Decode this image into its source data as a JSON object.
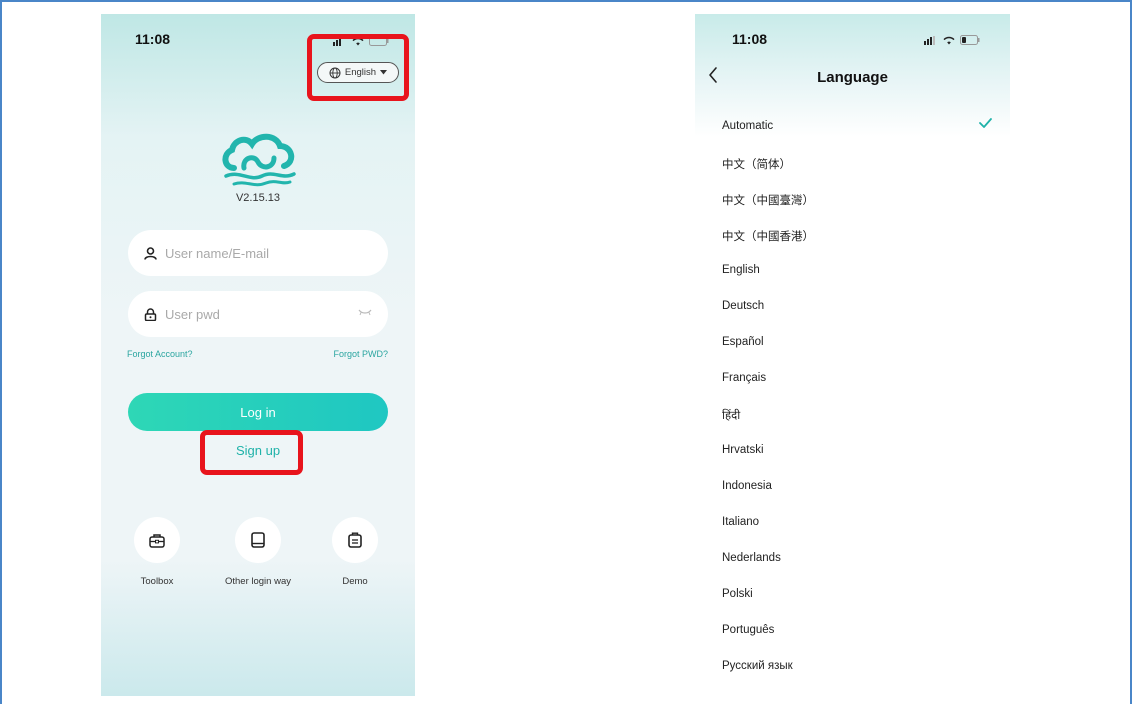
{
  "login_screen": {
    "status_time": "11:08",
    "language_selector": {
      "label": "English",
      "icon": "globe-icon"
    },
    "version": "V2.15.13",
    "username_field": {
      "placeholder": "User name/E-mail",
      "icon": "user-icon"
    },
    "password_field": {
      "placeholder": "User pwd",
      "icon": "lock-icon"
    },
    "forgot_account": "Forgot Account?",
    "forgot_pwd": "Forgot PWD?",
    "login_button": "Log in",
    "signup_link": "Sign up",
    "quick_actions": [
      {
        "label": "Toolbox",
        "icon": "toolbox-icon"
      },
      {
        "label": "Other login way",
        "icon": "tablet-icon"
      },
      {
        "label": "Demo",
        "icon": "demo-icon"
      }
    ],
    "accent_color": "#1fc7c2",
    "highlight_color": "#e8141c"
  },
  "language_screen": {
    "status_time": "11:08",
    "title": "Language",
    "selected": "Automatic",
    "items": [
      "Automatic",
      "中文（简体）",
      "中文（中國臺灣）",
      "中文（中國香港）",
      "English",
      "Deutsch",
      "Español",
      "Français",
      "हिंदी",
      "Hrvatski",
      "Indonesia",
      "Italiano",
      "Nederlands",
      "Polski",
      "Português",
      "Русский язык"
    ]
  }
}
